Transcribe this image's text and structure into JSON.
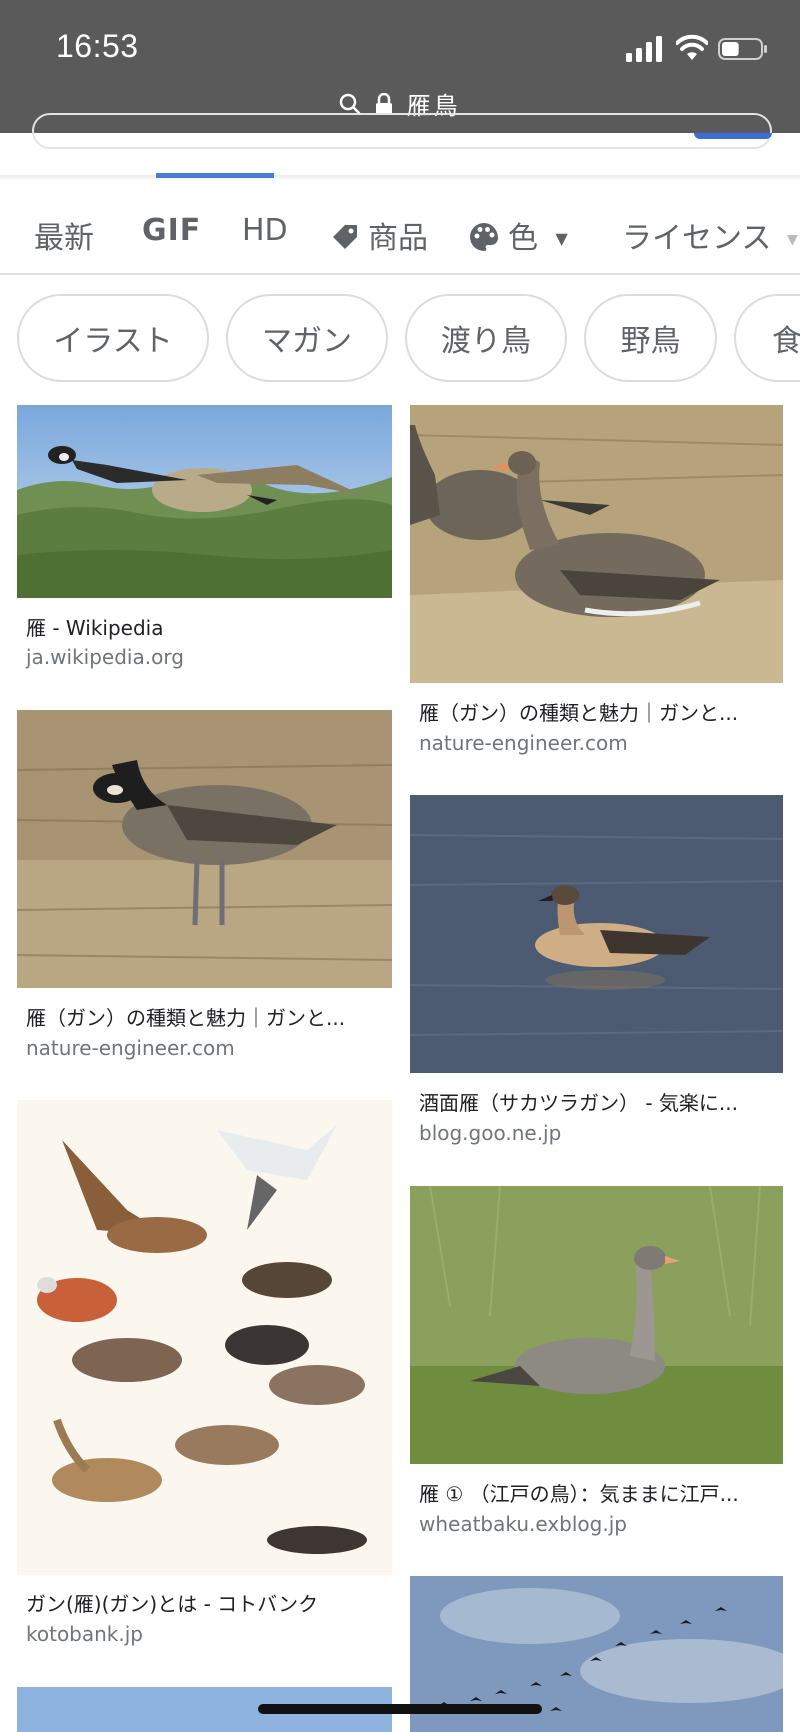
{
  "status_bar": {
    "time": "16:53",
    "battery_level": 0.45
  },
  "url_bar": {
    "text": "雁鳥"
  },
  "filters": [
    {
      "label": "最新"
    },
    {
      "label": "GIF"
    },
    {
      "label": "HD"
    },
    {
      "label": "商品",
      "icon": "tag-icon"
    },
    {
      "label": "色",
      "icon": "palette-icon"
    },
    {
      "label": "ライセンス"
    }
  ],
  "chips": [
    {
      "label": "イラスト"
    },
    {
      "label": "マガン"
    },
    {
      "label": "渡り鳥"
    },
    {
      "label": "野鳥"
    },
    {
      "label": "食"
    }
  ],
  "results": [
    {
      "title": "雁 - Wikipedia",
      "domain": "ja.wikipedia.org"
    },
    {
      "title": "雁（ガン）の種類と魅力｜ガンと...",
      "domain": "nature-engineer.com"
    },
    {
      "title": "雁（ガン）の種類と魅力｜ガンと...",
      "domain": "nature-engineer.com"
    },
    {
      "title": "酒面雁（サカツラガン） - 気楽に...",
      "domain": "blog.goo.ne.jp"
    },
    {
      "title": "ガン(雁)(ガン)とは - コトバンク",
      "domain": "kotobank.jp"
    },
    {
      "title": "雁 ① （江戸の鳥）：気ままに江戸...",
      "domain": "wheatbaku.exblog.jp"
    }
  ]
}
